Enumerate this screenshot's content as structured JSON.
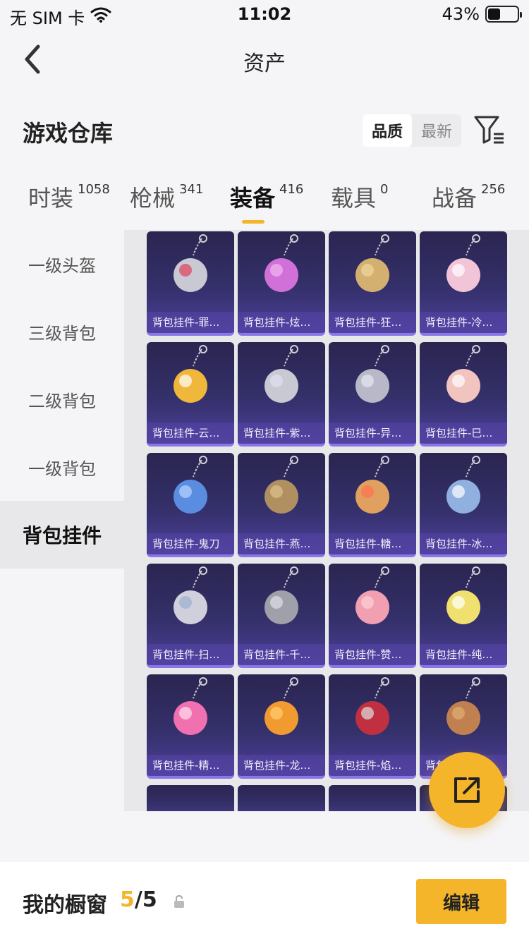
{
  "status_bar": {
    "carrier": "无 SIM 卡",
    "time": "11:02",
    "battery": "43%",
    "battery_level": 0.43
  },
  "nav": {
    "title": "资产",
    "back_icon": "chevron-left-icon"
  },
  "header": {
    "title": "游戏仓库",
    "sort_options": [
      "品质",
      "最新"
    ],
    "sort_active": "品质",
    "filter_icon": "filter-icon"
  },
  "tabs": [
    {
      "label": "时装",
      "count": "1058"
    },
    {
      "label": "枪械",
      "count": "341"
    },
    {
      "label": "装备",
      "count": "416",
      "active": true
    },
    {
      "label": "载具",
      "count": "0"
    },
    {
      "label": "战备",
      "count": "256"
    }
  ],
  "side_nav": [
    {
      "label": "一级头盔"
    },
    {
      "label": "三级背包"
    },
    {
      "label": "二级背包"
    },
    {
      "label": "一级背包"
    },
    {
      "label": "背包挂件",
      "active": true
    }
  ],
  "items": [
    "背包挂件-罪…",
    "背包挂件-炫…",
    "背包挂件-狂…",
    "背包挂件-冷…",
    "背包挂件-云…",
    "背包挂件-紫…",
    "背包挂件-异…",
    "背包挂件-巳…",
    "背包挂件-鬼刀",
    "背包挂件-燕…",
    "背包挂件-糖…",
    "背包挂件-冰…",
    "背包挂件-扫…",
    "背包挂件-千…",
    "背包挂件-赞…",
    "背包挂件-纯…",
    "背包挂件-精…",
    "背包挂件-龙…",
    "背包挂件-焰…",
    "背包挂件-…"
  ],
  "item_colors": {
    "card_top": "#2a2550",
    "card_bottom": "#4c3f9a",
    "accent": "#f5b52a"
  },
  "fab": {
    "icon": "share-icon"
  },
  "bottom_bar": {
    "label": "我的橱窗",
    "count_current": "5",
    "count_total": "/5",
    "lock_icon": "lock-icon",
    "edit_label": "编辑"
  }
}
